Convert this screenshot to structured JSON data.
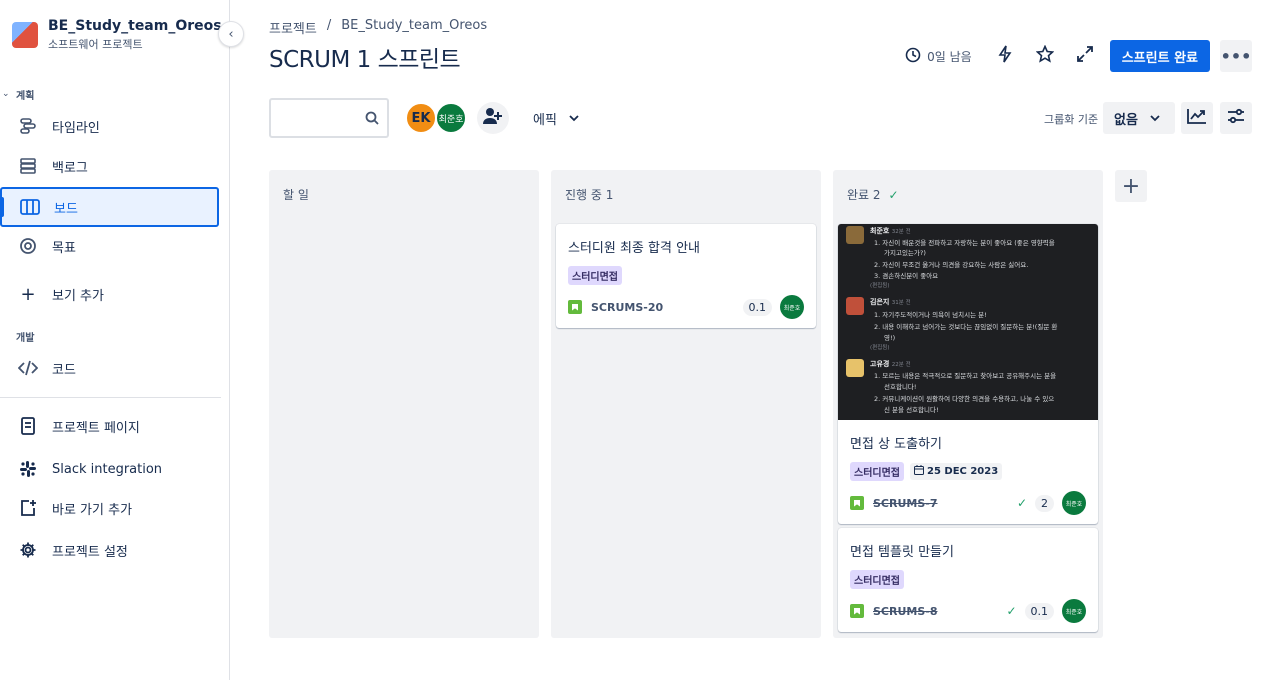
{
  "sidebar": {
    "project_name": "BE_Study_team_Oreos",
    "project_type": "소프트웨어 프로젝트",
    "section_planning": "계획",
    "section_dev": "개발",
    "items": {
      "timeline": "타임라인",
      "backlog": "백로그",
      "board": "보드",
      "goals": "목표",
      "add_view": "보기 추가",
      "code": "코드",
      "project_page": "프로젝트 페이지",
      "slack": "Slack integration",
      "add_shortcut": "바로 가기 추가",
      "settings": "프로젝트 설정"
    }
  },
  "header": {
    "breadcrumb_root": "프로젝트",
    "breadcrumb_sep": "/",
    "breadcrumb_project": "BE_Study_team_Oreos",
    "title": "SCRUM 1 스프린트",
    "days_left": "0일 남음",
    "complete_sprint": "스프린트 완료"
  },
  "toolbar": {
    "search_placeholder": "",
    "avatar_ek": "EK",
    "avatar_user": "최준호",
    "epic_label": "에픽",
    "group_by_label": "그룹화 기준",
    "group_by_value": "없음"
  },
  "columns": {
    "todo": "할 일",
    "in_progress": "진행 중 1",
    "done": "완료 2"
  },
  "cards": {
    "c20": {
      "title": "스터디원 최종 합격 안내",
      "label": "스터디면접",
      "key": "SCRUMS-20",
      "points": "0.1",
      "assignee": "최준호"
    },
    "c7": {
      "title": "면접 상 도출하기",
      "label": "스터디면접",
      "date": "25 DEC 2023",
      "key": "SCRUMS-7",
      "points": "2",
      "assignee": "최준호"
    },
    "c8": {
      "title": "면접 템플릿 만들기",
      "label": "스터디면접",
      "key": "SCRUMS-8",
      "points": "0.1",
      "assignee": "최준호"
    }
  },
  "chat_image": {
    "m1_name": "최준호",
    "m1_time": "32분 전",
    "m1_l1": "1.  자신이 배운것을 전파하고 자랑하는 분이 좋아요 (좋은 영향력을",
    "m1_l1b": "가지고있는가?)",
    "m1_l2": "2.  자신이 무조건 옳거나 의견을 강요하는 사람은 싫어요.",
    "m1_l3": "3.  겸손하신분이 좋아요",
    "m1_edit": "(편집됨)",
    "m2_name": "김은지",
    "m2_time": "31분 전",
    "m2_l1": "1.  자기주도적이거나 의욕이 넘치시는 분!",
    "m2_l2": "2.  내용 이해하고 넘어가는 것보다는 끊임없이 질문하는 분!(질문 환",
    "m2_l2b": "영!)",
    "m2_edit": "(편집됨)",
    "m3_name": "고유경",
    "m3_time": "22분 전",
    "m3_l1": "1.  모르는 내용은 적극적으로 질문하고 찾아보고 공유해주시는 분을",
    "m3_l1b": "선호합니다!",
    "m3_l2": "2.  커뮤니케이션이 원활하여 다양한 의견을 수용하고, 나눌 수 있으",
    "m3_l2b": "신 분을 선호합니다!"
  },
  "colors": {
    "primary": "#0c66e4",
    "label_bg": "#dfd8fd",
    "story_green": "#63ba3c",
    "avatar_ek": "#f18d13",
    "avatar_user": "#0a7a3e"
  }
}
